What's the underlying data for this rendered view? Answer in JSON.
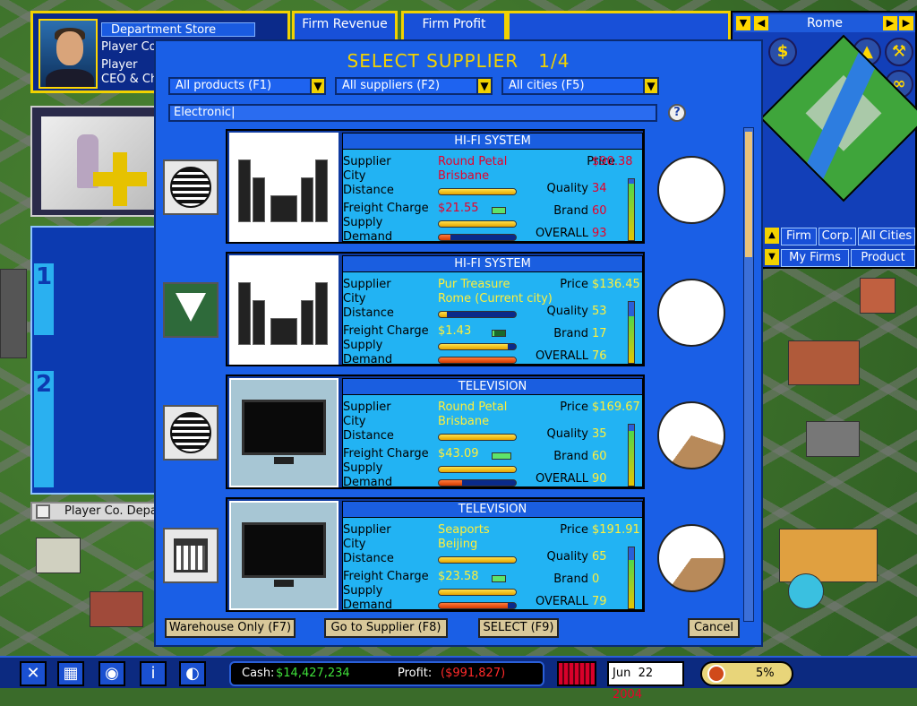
{
  "firm": {
    "name": "Department Store",
    "line1": "Player Co",
    "line2": "Player",
    "line3": "CEO & Ch"
  },
  "stats": {
    "revenue_label": "Firm Revenue",
    "profit_label": "Firm Profit"
  },
  "left_panel": {
    "footer_label": "Player Co. Depa",
    "tab1": "1",
    "tab2": "2"
  },
  "map": {
    "city": "Rome",
    "tabs": [
      "Firm",
      "Corp.",
      "All Cities",
      "My Firms",
      "Product"
    ]
  },
  "dialog": {
    "title": "SELECT SUPPLIER   1/4",
    "filters": [
      "All products (F1)",
      "All suppliers (F2)",
      "All cities (F5)"
    ],
    "search_value": "Electronic",
    "help_label": "?",
    "labels": {
      "supplier": "Supplier",
      "city": "City",
      "distance": "Distance",
      "freight": "Freight Charge",
      "supply": "Supply",
      "demand": "Demand",
      "price": "Price",
      "quality": "Quality",
      "brand": "Brand",
      "overall": "OVERALL"
    },
    "buttons": [
      "Warehouse Only (F7)",
      "Go to Supplier (F8)",
      "SELECT (F9)",
      "Cancel"
    ]
  },
  "suppliers": [
    {
      "product": "HI-FI SYSTEM",
      "supplier": "Round Petal",
      "city": "Brisbane",
      "freight": "$21.55",
      "price": "$90.38",
      "quality": "34",
      "brand": "60",
      "overall": "93",
      "color": "red",
      "logo": "sunburst-logo",
      "distance_fill": 1.0,
      "supply_fill": 1.0,
      "demand_fill": 0.15,
      "overall_fill": 0.93,
      "share": 0
    },
    {
      "product": "HI-FI SYSTEM",
      "supplier": "Pur Treasure",
      "city": "Rome  (Current city)",
      "freight": "$1.43",
      "price": "$136.45",
      "quality": "53",
      "brand": "17",
      "overall": "76",
      "color": "yellow",
      "logo": "diamond-logo",
      "distance_fill": 0.1,
      "supply_fill": 0.9,
      "demand_fill": 1.0,
      "overall_fill": 0.76,
      "share": 0
    },
    {
      "product": "TELEVISION",
      "supplier": "Round Petal",
      "city": "Brisbane",
      "freight": "$43.09",
      "price": "$169.67",
      "quality": "35",
      "brand": "60",
      "overall": "90",
      "color": "yellow",
      "logo": "sunburst-logo",
      "distance_fill": 1.0,
      "supply_fill": 1.0,
      "demand_fill": 0.3,
      "overall_fill": 0.9,
      "share": 0.3
    },
    {
      "product": "TELEVISION",
      "supplier": "Seaports",
      "city": "Beijing",
      "freight": "$23.58",
      "price": "$191.91",
      "quality": "65",
      "brand": "0",
      "overall": "79",
      "color": "yellow",
      "logo": "bank-logo",
      "distance_fill": 1.0,
      "supply_fill": 1.0,
      "demand_fill": 0.9,
      "overall_fill": 0.79,
      "share": 0.35
    }
  ],
  "status": {
    "cash_label": "Cash:",
    "cash": "$14,427,234",
    "profit_label": "Profit:",
    "profit": "($991,827)",
    "date_prefix": "Jun  22",
    "year": "2004",
    "speed": "5%"
  },
  "colors": {
    "accent": "#f2d200",
    "dialog_bg": "#1a5fe6",
    "info_bg": "#22b3f3",
    "red_text": "#e8002a",
    "yellow_text": "#ffef3a"
  }
}
